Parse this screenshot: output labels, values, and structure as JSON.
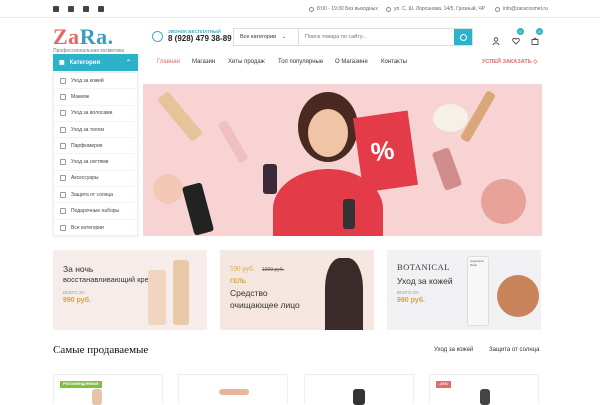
{
  "topbar": {
    "social": [
      "facebook-icon",
      "twitter-icon",
      "instagram-icon",
      "youtube-icon"
    ],
    "hours": "8:00 - 19:30 Без выходных",
    "address": "ул. С. Ш. Лорсанова, 14/5, Грозный, ЧР",
    "email": "info@zaracosmet.ru"
  },
  "logo": {
    "part1": "Za",
    "part2": "Ra.",
    "subtitle": "Профессиональная косметика"
  },
  "phone": {
    "caption": "ЗВОНОК БЕСПЛАТНЫЙ",
    "number": "8 (928) 479 38-89"
  },
  "search": {
    "category": "Все категории",
    "placeholder": "Поиск товара по сайту..."
  },
  "header_icons": {
    "wishlist_count": "0",
    "cart_count": "0"
  },
  "categories_button": "Категории",
  "nav": [
    "Главная",
    "Магазин",
    "Хиты продаж",
    "Топ популярные",
    "О Магазине",
    "Контакты"
  ],
  "cta": "УСПЕЙ ЗАКАЗАТЬ",
  "sidebar": [
    "Уход за кожей",
    "Макияж",
    "Уход за волосами",
    "Уход за телом",
    "Парфюмерия",
    "Уход за ногтями",
    "Аксессуары",
    "Защита от солнца",
    "Подарочные наборы",
    "Все категории"
  ],
  "hero": {
    "sale_symbol": "%"
  },
  "banners": [
    {
      "title1": "За ночь",
      "title2": "восстанавливающий крем",
      "small": "ВСЕГО ЗА",
      "price": "990 руб."
    },
    {
      "price_line": "590 руб.",
      "old_price": "1000 руб.",
      "tag": "ГЕЛЬ",
      "title1": "Средство",
      "title2": "очищающее лицо"
    },
    {
      "brand": "BOTANICAL",
      "product_brand": "Augustinus Bader",
      "title": "Уход за кожей",
      "small": "ВСЕГО ЗА",
      "price": "990 руб."
    }
  ],
  "bestsellers": {
    "title": "Самые продаваемые",
    "tabs": [
      "Уход за кожей",
      "Защита от солнца"
    ],
    "badges": [
      "РЕКОМЕНДУЕМЫЕ",
      "-21%"
    ]
  },
  "colors": {
    "accent": "#2db3c9",
    "brand_red": "#e36a6a",
    "price_gold": "#d4a443"
  }
}
